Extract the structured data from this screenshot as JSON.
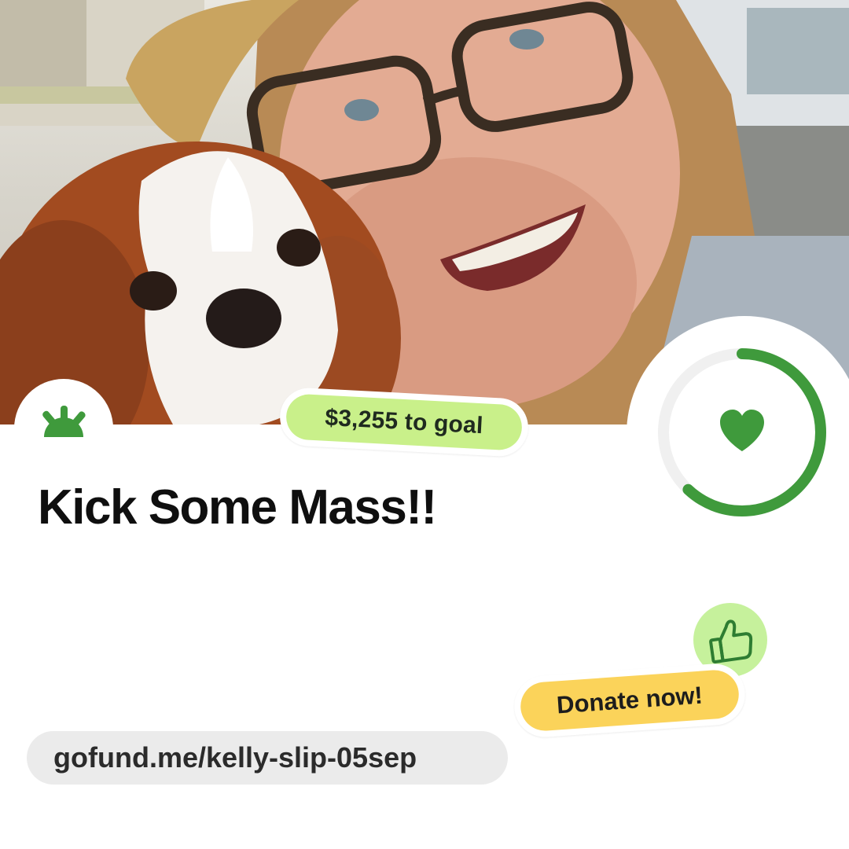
{
  "campaign": {
    "title": "Kick Some Mass!!",
    "url": "gofund.me/kelly-slip-05sep"
  },
  "badges": {
    "goal_remaining": "$3,255 to goal",
    "donate_label": "Donate now!"
  },
  "progress": {
    "fraction_raised": 0.62
  },
  "icons": {
    "brand": "sun-icon",
    "progress_center": "heart-icon",
    "reaction": "thumbs-up-icon"
  },
  "colors": {
    "brand_green": "#3f9a3c",
    "goal_pill": "#c9f08a",
    "donate_pill": "#fbd35a",
    "thumbs_bg": "#c6f19c",
    "url_bg": "#ebebeb"
  }
}
